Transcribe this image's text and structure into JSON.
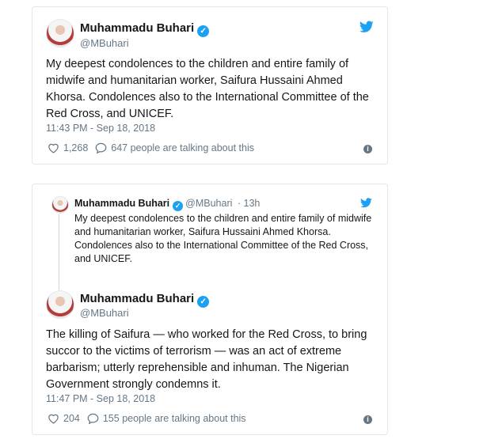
{
  "tweet1": {
    "name": "Muhammadu Buhari",
    "handle": "@MBuhari",
    "text": "My deepest condolences to the children and entire family of midwife and humanitarian worker, Saifura Hussaini Ahmed Khorsa. Condolences also to the International Committee of the Red Cross, and UNICEF.",
    "timestamp": "11:43 PM - Sep 18, 2018",
    "likes": "1,268",
    "talking": "647 people are talking about this"
  },
  "tweet2": {
    "quote": {
      "name": "Muhammadu Buhari",
      "handle": "@MBuhari",
      "age": "· 13h",
      "text": "My deepest condolences to the children and entire family of midwife and humanitarian worker, Saifura Hussaini Ahmed Khorsa. Condolences also to the International Committee of the Red Cross, and UNICEF."
    },
    "name": "Muhammadu Buhari",
    "handle": "@MBuhari",
    "text": "The killing of Saifura — who worked for the Red Cross, to bring succor to the victims of terrorism — was an act of extreme barbarism; utterly reprehensible and inhuman. The Nigerian Government strongly condemns it.",
    "timestamp": "11:47 PM - Sep 18, 2018",
    "likes": "204",
    "talking": "155 people are talking about this"
  },
  "icons": {
    "brand": "twitter-bird-icon",
    "verified": "verified-badge-icon",
    "like": "heart-icon",
    "reply": "speech-bubble-icon",
    "info": "info-icon"
  },
  "colors": {
    "brand": "#1da1f2",
    "muted": "#657786",
    "border": "#e1e8ed"
  }
}
